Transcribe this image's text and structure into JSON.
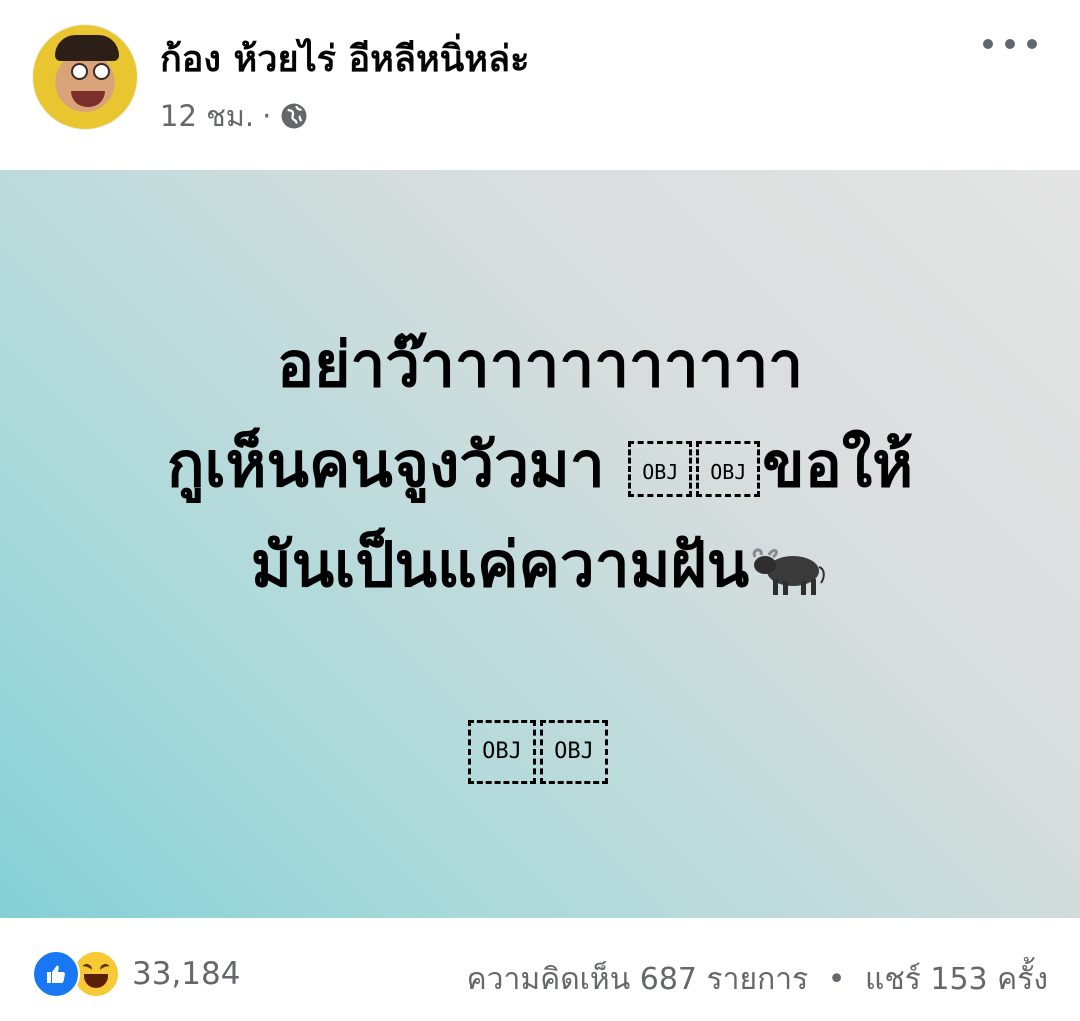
{
  "post": {
    "author": "ก้อง ห้วยไร่ อีหลีหนิ่หล่ะ",
    "time": "12 ชม.",
    "separator": "·",
    "privacy_icon": "globe-icon",
    "more_icon": "more-options-icon"
  },
  "content": {
    "background": "#a9d9da",
    "lines": [
      "อย่าว๊าาาาาาาาาาา",
      "กูเห็นคนจูงวัวมา",
      "ขอให้",
      "มันเป็นแค่ความฝัน"
    ],
    "placeholder_label": "OBJ",
    "emoji": "water-buffalo-icon"
  },
  "footer": {
    "reaction_icons": [
      "like-icon",
      "haha-icon"
    ],
    "reaction_count": "33,184",
    "comments": "ความคิดเห็น 687 รายการ",
    "bullet": "•",
    "shares": "แชร์ 153 ครั้ง"
  },
  "colors": {
    "like": "#1877f2",
    "haha": "#f7c934",
    "meta_text": "#65676b"
  }
}
